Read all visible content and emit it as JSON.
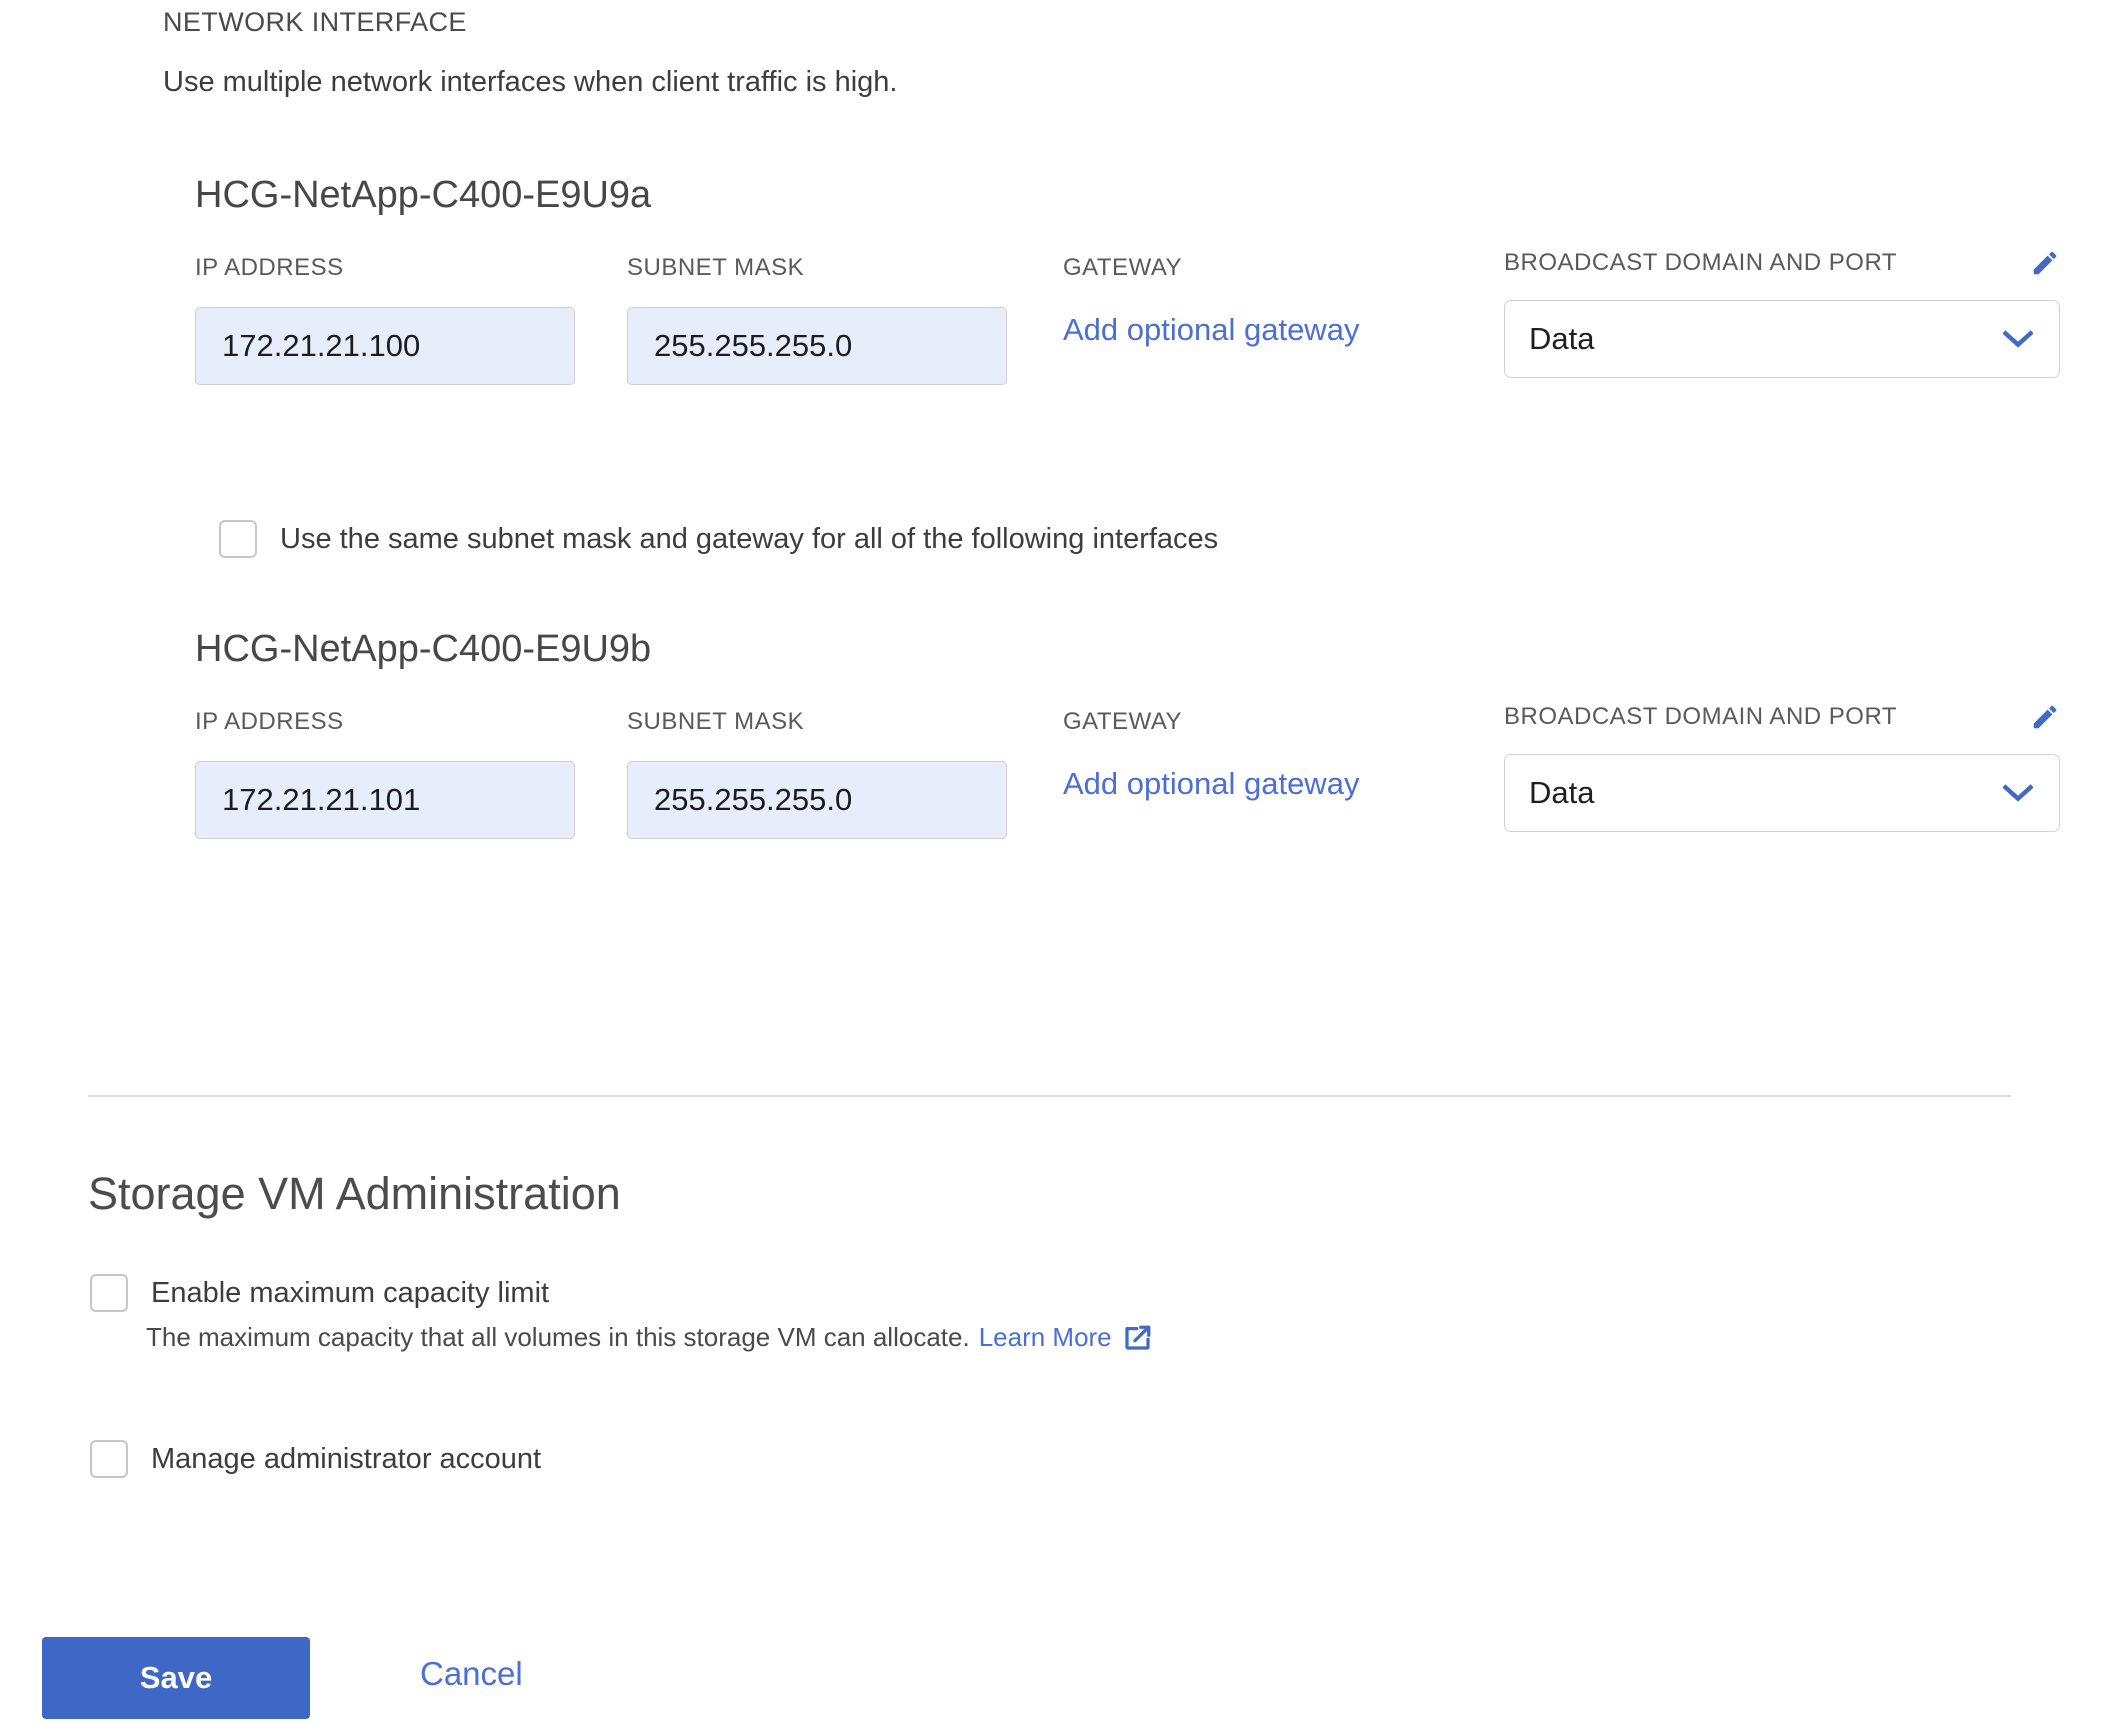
{
  "network_section": {
    "eyebrow": "NETWORK INTERFACE",
    "subtitle": "Use multiple network interfaces when client traffic is high.",
    "labels": {
      "ip_address": "IP ADDRESS",
      "subnet_mask": "SUBNET MASK",
      "gateway": "GATEWAY",
      "broadcast_domain_and_port": "BROADCAST DOMAIN AND PORT"
    },
    "gateway_link_label": "Add optional gateway",
    "interfaces": [
      {
        "name": "HCG-NetApp-C400-E9U9a",
        "ip_address": "172.21.21.100",
        "subnet_mask": "255.255.255.0",
        "broadcast_domain": "Data"
      },
      {
        "name": "HCG-NetApp-C400-E9U9b",
        "ip_address": "172.21.21.101",
        "subnet_mask": "255.255.255.0",
        "broadcast_domain": "Data"
      }
    ],
    "same_subnet_checkbox": {
      "label": "Use the same subnet mask and gateway for all of the following interfaces",
      "checked": false
    }
  },
  "storage_vm_admin": {
    "heading": "Storage VM Administration",
    "capacity_limit_checkbox": {
      "label": "Enable maximum capacity limit",
      "checked": false
    },
    "capacity_helper_text": "The maximum capacity that all volumes in this storage VM can allocate.",
    "capacity_helper_link": "Learn More",
    "manage_admin_checkbox": {
      "label": "Manage administrator account",
      "checked": false
    }
  },
  "footer": {
    "save_label": "Save",
    "cancel_label": "Cancel"
  },
  "colors": {
    "accent_blue": "#4b6fd6",
    "primary_button": "#3f68c6",
    "input_fill": "#e8edfb",
    "input_border": "#cfcfcf",
    "divider": "#dcdcdc",
    "text": "#3b3b3b",
    "label_text": "#5a5a5a"
  }
}
